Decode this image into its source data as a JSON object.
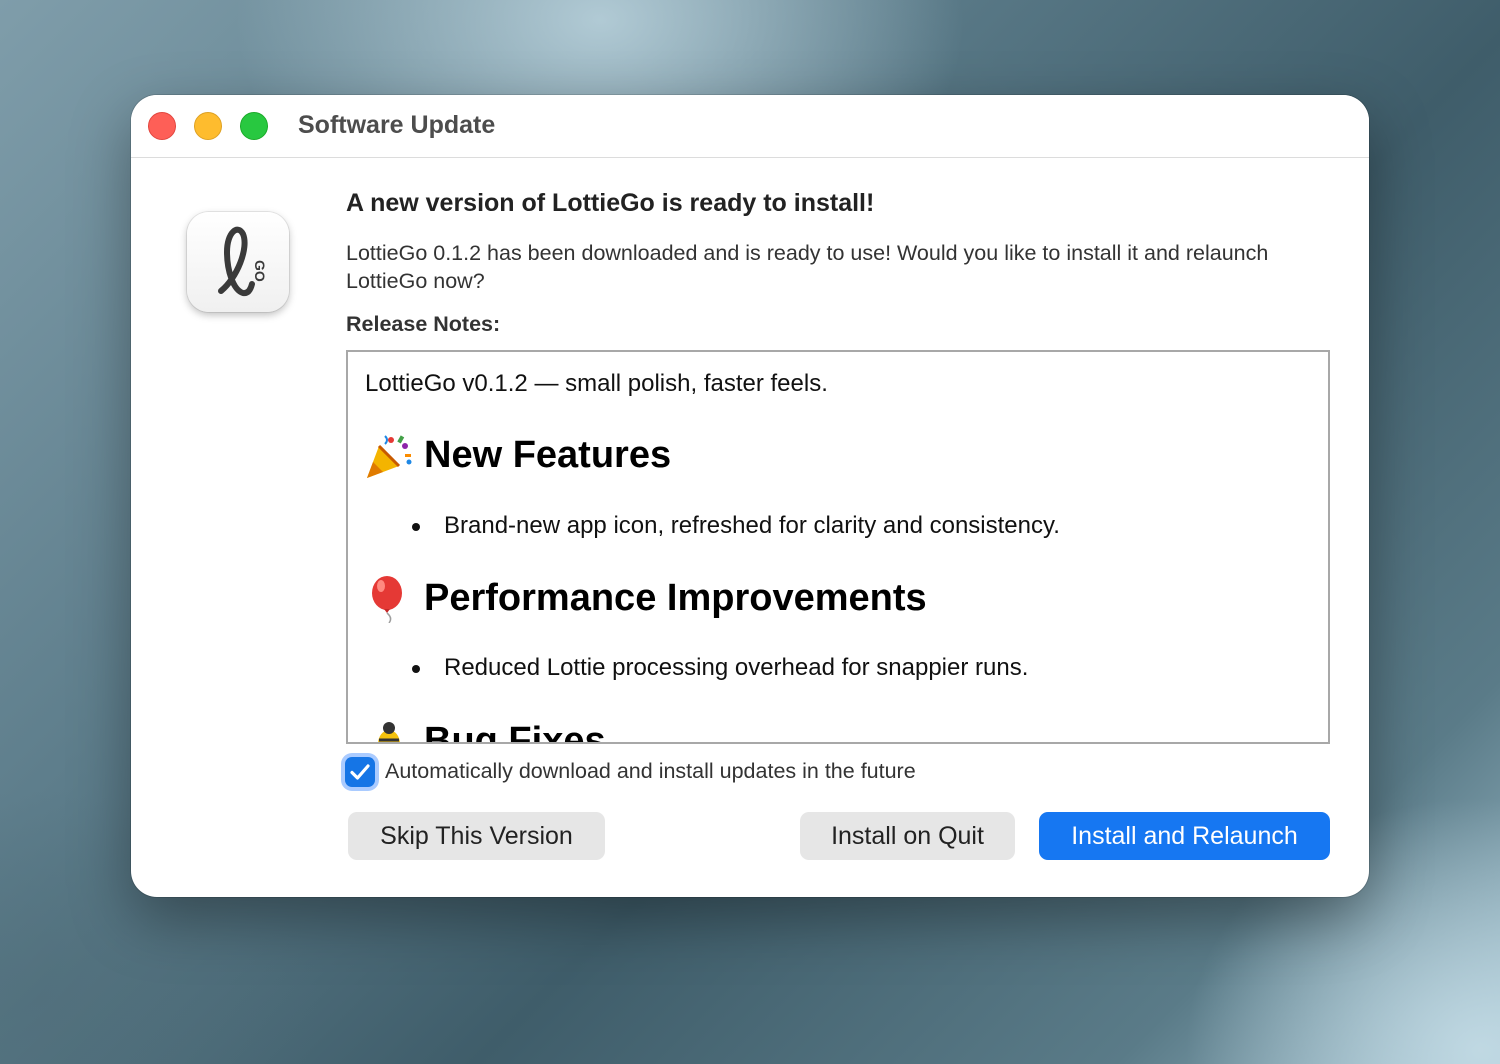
{
  "window": {
    "title": "Software Update"
  },
  "app_icon": {
    "name": "lottiego-app-icon",
    "letter": "ℓ",
    "badge_text": "GO"
  },
  "header": {
    "headline": "A new version of LottieGo is ready to install!",
    "message": "LottieGo 0.1.2 has been downloaded and is ready to use! Would you like to install it and relaunch LottieGo now?"
  },
  "release_notes": {
    "label": "Release Notes:",
    "intro": "LottieGo v0.1.2 — small polish, faster feels.",
    "sections": [
      {
        "icon": "party-popper-icon",
        "heading": "New Features",
        "items": [
          "Brand-new app icon, refreshed for clarity and consistency."
        ]
      },
      {
        "icon": "balloon-icon",
        "heading": "Performance Improvements",
        "items": [
          "Reduced Lottie processing overhead for snappier runs."
        ]
      },
      {
        "icon": "bug-icon",
        "heading": "Bug Fixes",
        "items": []
      }
    ]
  },
  "auto_update": {
    "checked": true,
    "label": "Automatically download and install updates in the future"
  },
  "buttons": {
    "skip": "Skip This Version",
    "install_on_quit": "Install on Quit",
    "install_relaunch": "Install and Relaunch"
  },
  "colors": {
    "accent": "#1677f2",
    "close": "#fe5f57",
    "minimize": "#febc2e",
    "maximize": "#28c840"
  }
}
